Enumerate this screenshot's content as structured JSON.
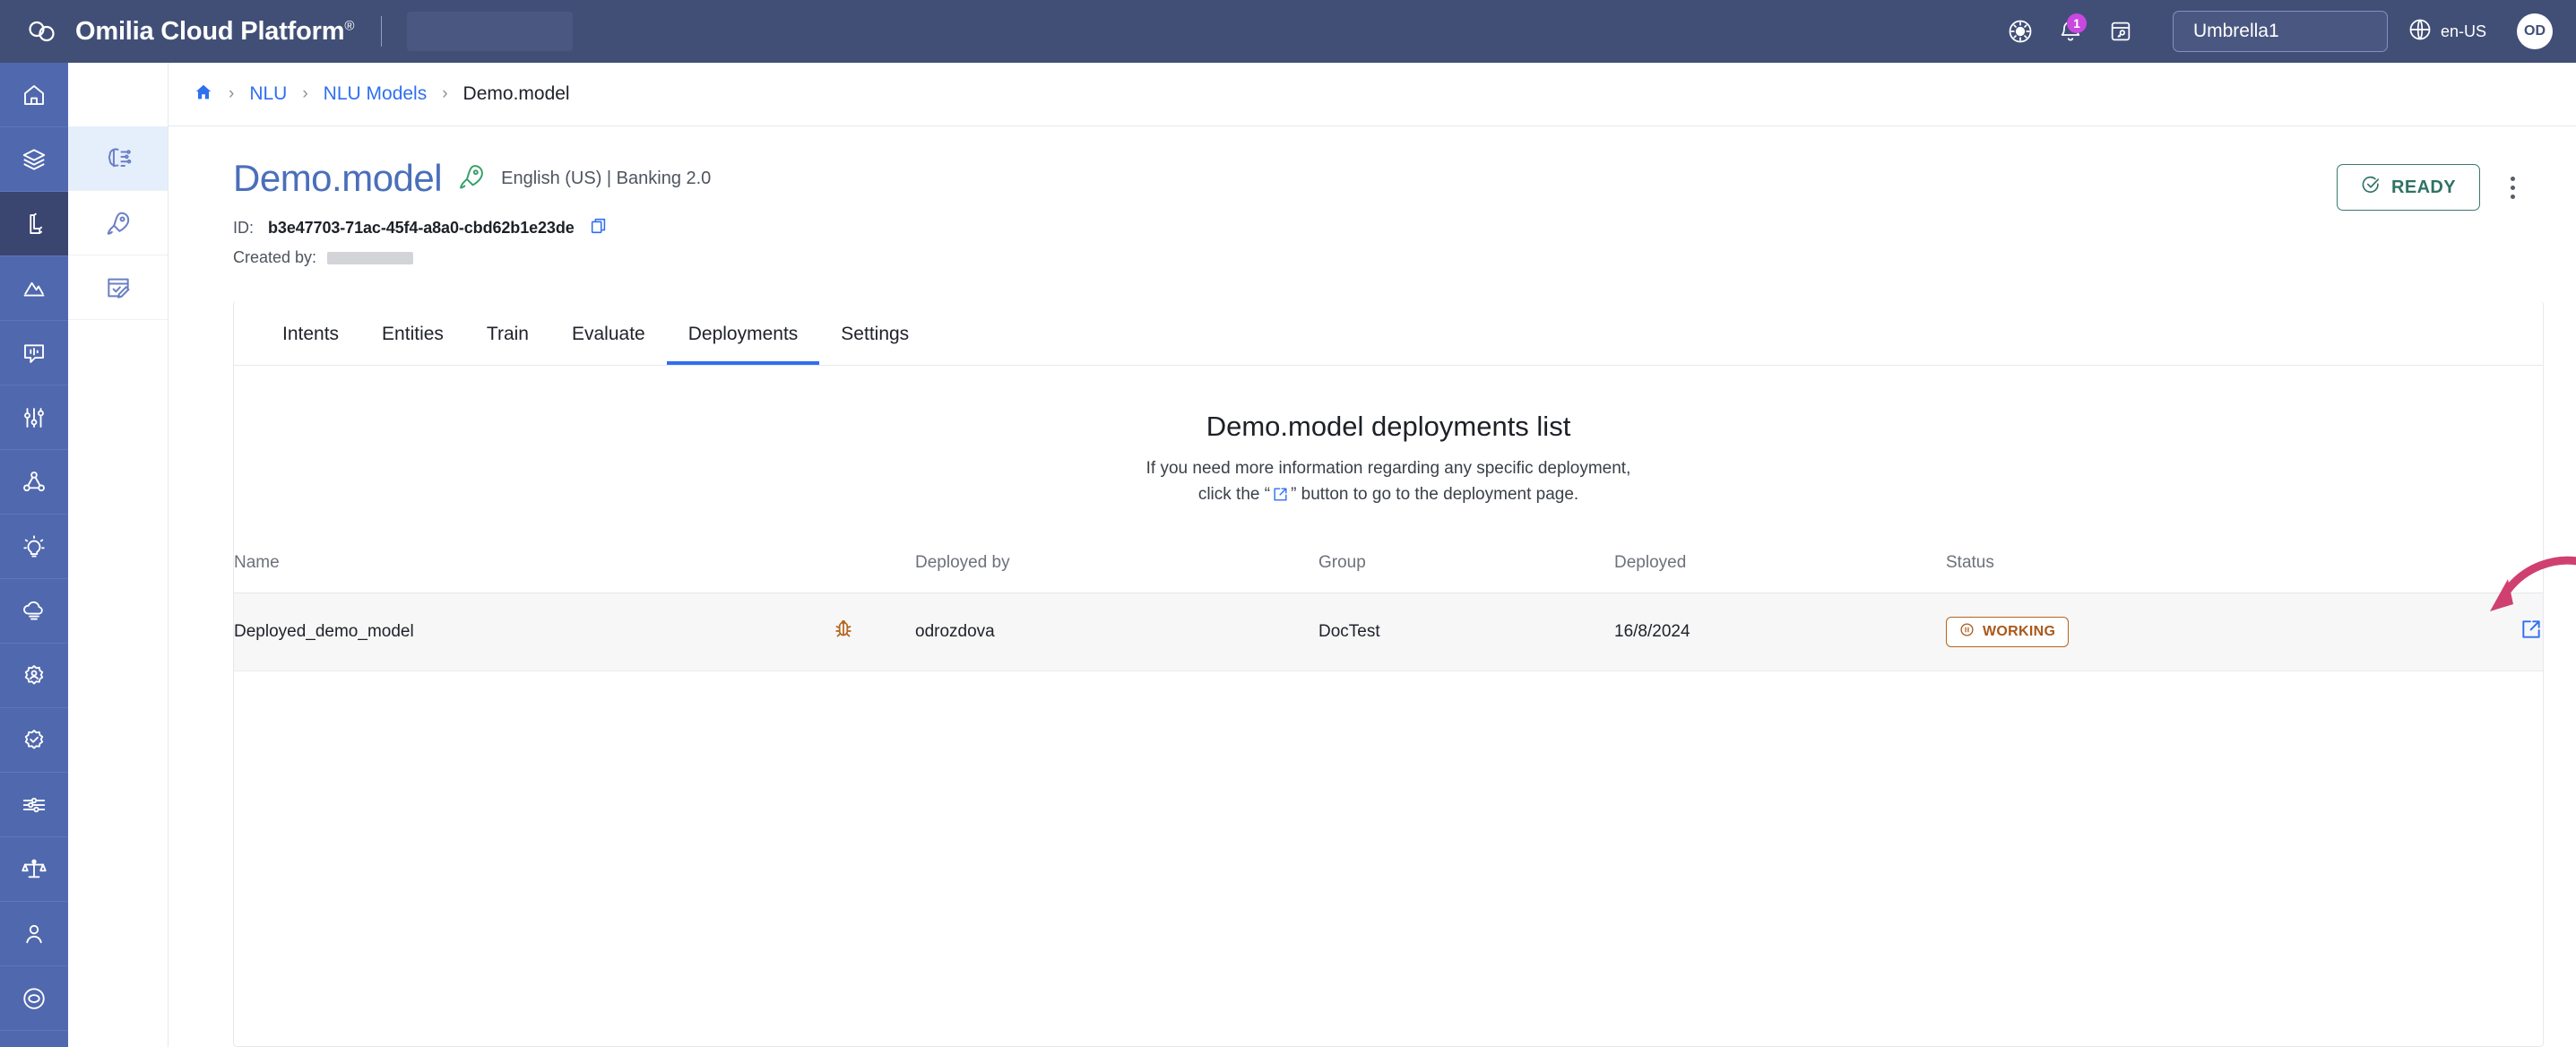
{
  "topbar": {
    "brand": "Omilia Cloud Platform",
    "brand_mark": "®",
    "logo_icon": "omilia-cloud-logo",
    "icons": {
      "theme": "brightness-icon",
      "notifications": "bell-icon",
      "notes": "note-key-icon",
      "language": "globe-icon"
    },
    "notification_count": "1",
    "tenant": "Umbrella1",
    "language": "en-US",
    "avatar_initials": "OD"
  },
  "rail": {
    "items": [
      {
        "name": "home",
        "icon": "home-icon",
        "active": false
      },
      {
        "name": "layers",
        "icon": "layers-icon",
        "active": false
      },
      {
        "name": "nlu",
        "icon": "nlu-block-icon",
        "active": true
      },
      {
        "name": "analytics",
        "icon": "analytics-chart-icon",
        "active": false
      },
      {
        "name": "conversations",
        "icon": "chat-bars-icon",
        "active": false
      },
      {
        "name": "tuning",
        "icon": "sliders-icon",
        "active": false
      },
      {
        "name": "flows",
        "icon": "nodes-icon",
        "active": false
      },
      {
        "name": "insights",
        "icon": "lightbulb-icon",
        "active": false
      },
      {
        "name": "cloud-speech",
        "icon": "cloud-lines-icon",
        "active": false
      },
      {
        "name": "identity",
        "icon": "badge-user-icon",
        "active": false
      },
      {
        "name": "verification",
        "icon": "badge-check-icon",
        "active": false
      },
      {
        "name": "integrations",
        "icon": "circuit-icon",
        "active": false
      },
      {
        "name": "compliance",
        "icon": "scales-icon",
        "active": false
      },
      {
        "name": "users",
        "icon": "user-icon",
        "active": false
      },
      {
        "name": "support",
        "icon": "lifebuoy-icon",
        "active": false
      }
    ]
  },
  "subrail": {
    "items": [
      {
        "name": "nlu-models",
        "icon": "brain-icon",
        "active": true
      },
      {
        "name": "deployments",
        "icon": "rocket-icon",
        "active": false
      },
      {
        "name": "annotations",
        "icon": "form-edit-icon",
        "active": false
      }
    ]
  },
  "breadcrumb": {
    "home_icon": "home-icon",
    "separator": "›",
    "items": [
      {
        "label": "NLU",
        "current": false
      },
      {
        "label": "NLU Models",
        "current": false
      },
      {
        "label": "Demo.model",
        "current": true
      }
    ]
  },
  "model": {
    "title": "Demo.model",
    "rocket_icon": "rocket-icon",
    "subtitle": "English (US) | Banking 2.0",
    "id_label": "ID:",
    "id_value": "b3e47703-71ac-45f4-a8a0-cbd62b1e23de",
    "copy_icon": "copy-icon",
    "created_by_label": "Created by:",
    "created_by_value": "",
    "status": {
      "label": "READY",
      "icon": "check-circle-icon",
      "color": "#2f7265"
    },
    "menu_icon": "kebab-menu-icon"
  },
  "tabs": [
    {
      "label": "Intents",
      "active": false
    },
    {
      "label": "Entities",
      "active": false
    },
    {
      "label": "Train",
      "active": false
    },
    {
      "label": "Evaluate",
      "active": false
    },
    {
      "label": "Deployments",
      "active": true
    },
    {
      "label": "Settings",
      "active": false
    }
  ],
  "panel": {
    "title": "Demo.model deployments list",
    "desc_line1": "If you need more information regarding any specific deployment,",
    "desc_prefix": "click the “",
    "desc_suffix": "” button to go to the deployment page.",
    "desc_icon": "external-link-icon"
  },
  "table": {
    "columns": [
      "Name",
      "",
      "Deployed by",
      "Group",
      "Deployed",
      "Status",
      ""
    ],
    "rows": [
      {
        "name": "Deployed_demo_model",
        "bug_icon": "bug-icon",
        "deployed_by": "odrozdova",
        "group": "DocTest",
        "deployed": "16/8/2024",
        "status": "WORKING",
        "status_icon": "pause-circle-icon",
        "status_color": "#a9591a",
        "action_icon": "external-link-icon"
      }
    ]
  },
  "annotation": {
    "arrow": "curved-arrow-annotation",
    "color": "#cf4071"
  }
}
